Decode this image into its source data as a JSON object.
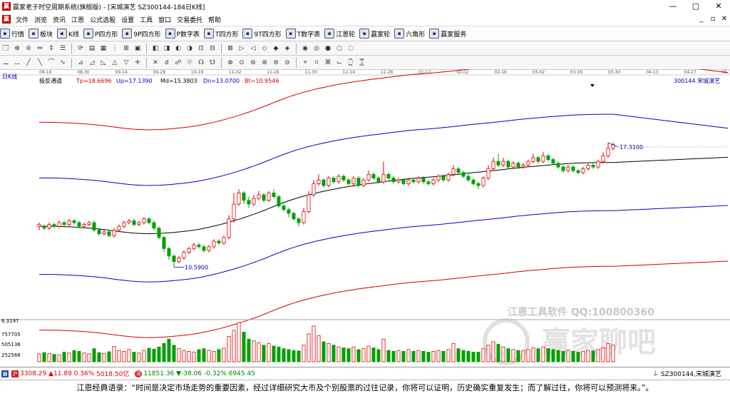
{
  "window": {
    "title": "赢家老子时空周期系统(旗舰版) - [宋城演艺  SZ300144-184日K线]",
    "min": "—",
    "max": "▢",
    "close": "✕"
  },
  "menu": {
    "items": [
      "文件",
      "浏览",
      "资讯",
      "江恩",
      "公式选股",
      "设置",
      "工具",
      "窗口",
      "交易委托",
      "帮助"
    ],
    "right": [
      "_",
      "▫",
      "✕"
    ]
  },
  "toolbar1": [
    "行情",
    "板块",
    "K线",
    "P四方形",
    "9P四方形",
    "P数字表",
    "T四方形",
    "9T四方形",
    "T数字表",
    "江恩轮",
    "赢家轮",
    "六角形",
    "赢家服务"
  ],
  "toolbar2": [
    "🗔",
    "⊕",
    "⊖",
    "⇔",
    "↕",
    "☰",
    "⟳",
    "▤",
    "▦",
    "⋮",
    "⊞",
    "▣",
    "◧",
    "◨",
    "◐",
    "◑",
    "⊡",
    "⊟",
    "⊠",
    "▷",
    "◁",
    "◇",
    "◆",
    "◈",
    "◉",
    "◎",
    "●",
    "○",
    "◌"
  ],
  "toolbar3": [
    "⚊",
    "⚋",
    "╱",
    "╲",
    "⌒",
    "∿",
    "⊿",
    "◿",
    "◺",
    "△",
    "▽",
    "✛",
    "✕",
    "☌",
    "☍",
    "☉",
    "☊",
    "☋",
    "⊗",
    "⊙",
    "⊚",
    "⊛",
    "⊜",
    "⊝",
    "⌖",
    "⌗",
    "⌘",
    "⌙",
    "⌚",
    "⌛"
  ],
  "chart_data": {
    "type": "candlestick",
    "period_label": "日K线",
    "x_ticks": [
      "08-16",
      "08-30",
      "09-14",
      "09-28",
      "10-19",
      "11-02",
      "11-16",
      "11-30",
      "12-14",
      "12-28",
      "01-12",
      "02-02",
      "02-16",
      "03-02",
      "03-16",
      "03-30",
      "04-13",
      "04-27",
      "05-11"
    ],
    "indicator": {
      "name": "极反通道",
      "Tp": "Tp=18.6696",
      "Up": "Up=17.1390",
      "Md": "Md=15.3803",
      "Dn": "Dn=13.0700",
      "Bt": "Bt=10.9546"
    },
    "stock": "300144  宋城演艺",
    "annotations": {
      "high": "17.3100",
      "low": "10.5900"
    },
    "price_range": [
      8.0,
      20.5
    ],
    "candles": [
      [
        12.8,
        12.9,
        12.6,
        13.0
      ],
      [
        12.8,
        12.7,
        12.6,
        12.9
      ],
      [
        12.7,
        12.9,
        12.6,
        13.0
      ],
      [
        12.9,
        12.8,
        12.7,
        13.0
      ],
      [
        12.8,
        13.0,
        12.7,
        13.1
      ],
      [
        13.0,
        12.9,
        12.8,
        13.1
      ],
      [
        12.9,
        13.1,
        12.8,
        13.2
      ],
      [
        13.1,
        13.0,
        12.9,
        13.2
      ],
      [
        13.0,
        12.8,
        12.7,
        13.1
      ],
      [
        12.8,
        12.9,
        12.7,
        13.0
      ],
      [
        12.9,
        13.0,
        12.8,
        13.1
      ],
      [
        13.0,
        12.6,
        12.5,
        13.1
      ],
      [
        12.6,
        12.4,
        12.3,
        12.7
      ],
      [
        12.4,
        12.5,
        12.3,
        12.6
      ],
      [
        12.5,
        12.3,
        12.2,
        12.6
      ],
      [
        12.3,
        12.6,
        12.2,
        12.7
      ],
      [
        12.6,
        12.8,
        12.5,
        12.9
      ],
      [
        12.8,
        13.0,
        12.7,
        13.1
      ],
      [
        13.0,
        13.1,
        12.9,
        13.2
      ],
      [
        13.1,
        12.9,
        12.8,
        13.2
      ],
      [
        12.9,
        13.0,
        12.8,
        13.1
      ],
      [
        13.0,
        13.2,
        12.9,
        13.3
      ],
      [
        13.2,
        13.0,
        12.9,
        13.3
      ],
      [
        13.0,
        12.7,
        12.6,
        13.1
      ],
      [
        12.7,
        12.2,
        12.1,
        12.8
      ],
      [
        12.2,
        11.6,
        11.4,
        12.3
      ],
      [
        11.6,
        11.2,
        11.0,
        11.7
      ],
      [
        11.2,
        10.9,
        10.6,
        11.3
      ],
      [
        10.9,
        11.1,
        10.8,
        11.2
      ],
      [
        11.1,
        11.4,
        11.0,
        11.5
      ],
      [
        11.4,
        11.6,
        11.3,
        11.7
      ],
      [
        11.6,
        11.8,
        11.5,
        11.9
      ],
      [
        11.8,
        11.7,
        11.6,
        11.9
      ],
      [
        11.7,
        11.5,
        11.4,
        11.8
      ],
      [
        11.5,
        11.7,
        11.4,
        11.8
      ],
      [
        11.7,
        12.0,
        11.6,
        12.1
      ],
      [
        12.0,
        11.9,
        11.8,
        12.1
      ],
      [
        11.9,
        12.2,
        11.8,
        12.3
      ],
      [
        12.2,
        13.2,
        12.1,
        13.4
      ],
      [
        13.2,
        14.0,
        13.0,
        14.6
      ],
      [
        14.0,
        14.6,
        13.9,
        14.8
      ],
      [
        14.6,
        14.2,
        14.0,
        14.7
      ],
      [
        14.2,
        14.0,
        13.8,
        14.4
      ],
      [
        14.0,
        14.3,
        13.9,
        14.5
      ],
      [
        14.3,
        14.5,
        14.2,
        14.7
      ],
      [
        14.5,
        14.2,
        14.1,
        14.6
      ],
      [
        14.2,
        14.6,
        14.1,
        14.7
      ],
      [
        14.6,
        14.4,
        14.3,
        14.8
      ],
      [
        14.4,
        13.9,
        13.8,
        14.5
      ],
      [
        13.9,
        13.7,
        13.6,
        14.0
      ],
      [
        13.7,
        13.5,
        13.3,
        13.8
      ],
      [
        13.5,
        13.2,
        13.1,
        13.6
      ],
      [
        13.2,
        13.0,
        12.8,
        13.3
      ],
      [
        13.0,
        13.6,
        12.9,
        13.8
      ],
      [
        13.6,
        14.5,
        13.5,
        14.7
      ],
      [
        14.5,
        15.1,
        14.4,
        15.3
      ],
      [
        15.1,
        15.3,
        15.0,
        15.6
      ],
      [
        15.3,
        15.0,
        14.9,
        15.4
      ],
      [
        15.0,
        15.4,
        14.9,
        15.5
      ],
      [
        15.4,
        15.2,
        15.1,
        15.5
      ],
      [
        15.2,
        15.5,
        15.1,
        15.6
      ],
      [
        15.5,
        15.3,
        15.2,
        15.6
      ],
      [
        15.3,
        15.1,
        15.0,
        15.4
      ],
      [
        15.1,
        15.4,
        15.0,
        15.5
      ],
      [
        15.4,
        15.0,
        14.9,
        15.5
      ],
      [
        15.0,
        15.3,
        14.9,
        15.4
      ],
      [
        15.3,
        15.6,
        15.2,
        15.8
      ],
      [
        15.6,
        15.4,
        15.3,
        15.7
      ],
      [
        15.4,
        15.2,
        15.1,
        15.5
      ],
      [
        15.2,
        15.6,
        15.1,
        16.3
      ],
      [
        15.6,
        15.4,
        15.3,
        15.7
      ],
      [
        15.4,
        15.2,
        15.1,
        15.5
      ],
      [
        15.2,
        15.3,
        15.1,
        15.4
      ],
      [
        15.3,
        15.1,
        15.0,
        15.4
      ],
      [
        15.1,
        15.3,
        15.0,
        15.4
      ],
      [
        15.3,
        15.2,
        15.1,
        15.4
      ],
      [
        15.2,
        15.4,
        15.1,
        15.5
      ],
      [
        15.4,
        15.2,
        15.1,
        15.5
      ],
      [
        15.2,
        15.1,
        15.0,
        15.3
      ],
      [
        15.1,
        15.3,
        15.0,
        15.4
      ],
      [
        15.3,
        15.5,
        15.2,
        15.6
      ],
      [
        15.5,
        15.3,
        15.2,
        15.6
      ],
      [
        15.3,
        15.6,
        15.2,
        15.7
      ],
      [
        15.6,
        15.9,
        15.5,
        16.1
      ],
      [
        15.9,
        15.7,
        15.6,
        16.0
      ],
      [
        15.7,
        15.5,
        15.4,
        15.8
      ],
      [
        15.5,
        15.3,
        15.2,
        15.6
      ],
      [
        15.3,
        15.1,
        15.0,
        15.4
      ],
      [
        15.1,
        15.0,
        14.8,
        15.2
      ],
      [
        15.0,
        15.4,
        14.9,
        15.5
      ],
      [
        15.4,
        15.9,
        15.3,
        16.1
      ],
      [
        15.9,
        16.3,
        15.8,
        16.5
      ],
      [
        16.3,
        16.1,
        16.0,
        16.7
      ],
      [
        16.1,
        16.3,
        16.0,
        16.5
      ],
      [
        16.3,
        16.0,
        15.9,
        16.4
      ],
      [
        16.0,
        16.2,
        15.9,
        16.3
      ],
      [
        16.2,
        16.0,
        15.9,
        16.3
      ],
      [
        16.0,
        16.1,
        15.9,
        16.2
      ],
      [
        16.1,
        16.3,
        16.0,
        16.4
      ],
      [
        16.3,
        16.5,
        16.2,
        16.7
      ],
      [
        16.5,
        16.3,
        16.2,
        16.6
      ],
      [
        16.3,
        16.6,
        16.2,
        16.8
      ],
      [
        16.6,
        16.4,
        16.3,
        16.7
      ],
      [
        16.4,
        16.2,
        16.1,
        16.5
      ],
      [
        16.2,
        16.0,
        15.9,
        16.3
      ],
      [
        16.0,
        15.8,
        15.7,
        16.1
      ],
      [
        15.8,
        16.0,
        15.7,
        16.1
      ],
      [
        16.0,
        15.8,
        15.7,
        16.1
      ],
      [
        15.8,
        15.7,
        15.6,
        15.9
      ],
      [
        15.7,
        15.9,
        15.6,
        16.0
      ],
      [
        15.9,
        16.1,
        15.8,
        16.2
      ],
      [
        16.1,
        16.0,
        15.9,
        16.2
      ],
      [
        16.0,
        16.3,
        15.9,
        16.4
      ],
      [
        16.3,
        16.6,
        16.2,
        16.8
      ],
      [
        16.6,
        17.0,
        16.5,
        17.31
      ],
      [
        17.0,
        17.2,
        16.9,
        17.31
      ]
    ],
    "volume_axis": [
      "6.3197",
      "757705",
      "505136",
      "252568"
    ]
  },
  "volume": [
    180,
    210,
    190,
    170,
    160,
    220,
    200,
    260,
    240,
    200,
    180,
    300,
    210,
    190,
    230,
    350,
    260,
    240,
    280,
    220,
    200,
    260,
    310,
    290,
    340,
    420,
    520,
    380,
    300,
    260,
    240,
    220,
    280,
    300,
    260,
    240,
    280,
    310,
    580,
    720,
    900,
    680,
    520,
    480,
    440,
    380,
    420,
    360,
    340,
    300,
    280,
    260,
    250,
    380,
    640,
    820,
    600,
    460,
    420,
    380,
    340,
    320,
    300,
    340,
    280,
    300,
    360,
    320,
    280,
    520,
    260,
    240,
    260,
    240,
    280,
    240,
    260,
    240,
    220,
    240,
    260,
    240,
    280,
    420,
    300,
    260,
    240,
    220,
    220,
    300,
    380,
    460,
    400,
    340,
    300,
    280,
    260,
    260,
    280,
    320,
    300,
    340,
    300,
    280,
    260,
    240,
    260,
    240,
    220,
    240,
    260,
    250,
    280,
    320,
    420,
    380
  ],
  "watermark": {
    "line1": "江恩工具软件  QQ:100800360",
    "line2": "赢家聊吧",
    "line3": "jiaoba.yx"
  },
  "status": {
    "sh_index": "3308.29",
    "sh_chg": "▲11.89",
    "sh_pct": "0.36%",
    "sh_amt": "5018.50亿",
    "sz_index": "11851.36",
    "sz_chg": "▼-38.06",
    "sz_pct": "-0.32%",
    "sz_amt": "6945.45",
    "sh_badge": "沪",
    "sz_badge": "深",
    "code": "SZ300144,宋城演艺"
  },
  "quote": "江恩经典语录：“时间是决定市场走势的重要因素，经过详细研究大市及个别股票的过往记录，你将可以证明，历史确实重复发生；而了解过往，你将可以预测将来。”。",
  "colors": {
    "up": "#e00000",
    "down": "#00a000",
    "upper_band": "#d00000",
    "mid_band": "#0000cc",
    "ma": "#000000"
  }
}
